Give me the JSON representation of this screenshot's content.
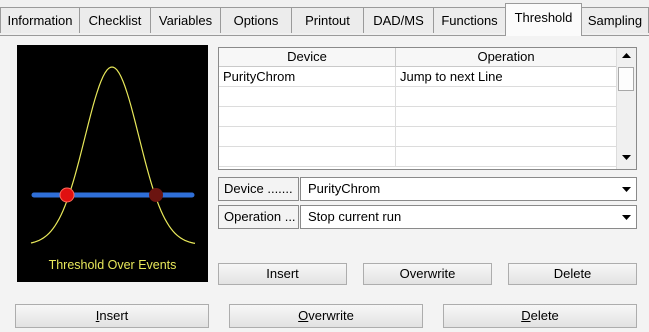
{
  "tabs": [
    {
      "label": "Information",
      "active": false
    },
    {
      "label": "Checklist",
      "active": false
    },
    {
      "label": "Variables",
      "active": false
    },
    {
      "label": "Options",
      "active": false
    },
    {
      "label": "Printout",
      "active": false
    },
    {
      "label": "DAD/MS",
      "active": false
    },
    {
      "label": "Functions",
      "active": false
    },
    {
      "label": "Threshold",
      "active": true
    },
    {
      "label": "Sampling",
      "active": false
    }
  ],
  "graph": {
    "caption": "Threshold Over Events",
    "curve_color": "#e8e85a",
    "threshold_line_color": "#2f6fd8",
    "event_marker_color": "#e01010",
    "event_marker_dim_color": "#6b1410"
  },
  "table": {
    "columns": [
      "Device",
      "Operation"
    ],
    "rows": [
      [
        "PurityChrom",
        "Jump to next Line"
      ],
      [
        "",
        ""
      ],
      [
        "",
        ""
      ],
      [
        "",
        ""
      ],
      [
        "",
        ""
      ]
    ],
    "scroll_up_icon": "arrow-up-icon",
    "scroll_down_icon": "arrow-down-icon"
  },
  "device_field": {
    "label": "Device .......",
    "value": "PurityChrom"
  },
  "operation_field": {
    "label": "Operation ...",
    "value": "Stop current run"
  },
  "inner_buttons": {
    "insert": {
      "first": "I",
      "rest": "nsert"
    },
    "overwrite": {
      "first": "O",
      "rest": "verwrite"
    },
    "delete": {
      "first": "D",
      "rest": "elete"
    }
  },
  "outer_buttons": {
    "insert": {
      "first": "I",
      "rest": "nsert"
    },
    "overwrite": {
      "first": "O",
      "rest": "verwrite"
    },
    "delete": {
      "first": "D",
      "rest": "elete"
    }
  }
}
